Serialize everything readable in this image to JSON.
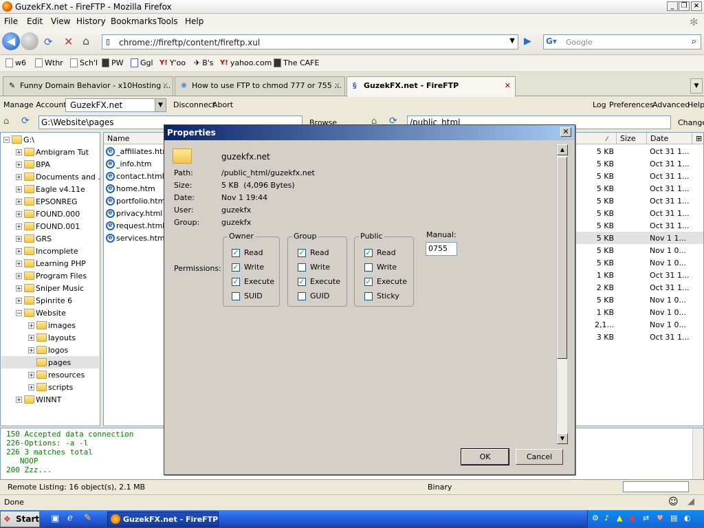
{
  "window": {
    "title": "GuzekFX.net - FireFTP - Mozilla Firefox"
  },
  "menu": [
    "File",
    "Edit",
    "View",
    "History",
    "Bookmarks",
    "Tools",
    "Help"
  ],
  "nav": {
    "url": "chrome://fireftp/content/fireftp.xul",
    "search_placeholder": "Google"
  },
  "bookmarks": [
    "w6",
    "Wthr",
    "Sch'l",
    "PW",
    "Ggl",
    "Y'oo",
    "B's",
    "yahoo.com",
    "The CAFE"
  ],
  "tabs": [
    {
      "label": "Funny Domain Behavior - x10Hosting ..."
    },
    {
      "label": "How to use FTP to chmod 777 or 755 ..."
    },
    {
      "label": "GuzekFX.net - FireFTP"
    }
  ],
  "ftp_toolbar": {
    "manage_accounts": "Manage Accounts",
    "account": "GuzekFX.net",
    "disconnect": "Disconnect",
    "abort": "Abort",
    "log": "Log",
    "preferences": "Preferences",
    "advanced": "Advanced",
    "help": "Help"
  },
  "paths": {
    "local": "G:\\Website\\pages",
    "browse": "Browse",
    "remote": "/public_html",
    "change": "Change"
  },
  "tree": {
    "root": "G:\\",
    "items": [
      "Ambigram Tut",
      "BPA",
      "Documents and ...",
      "Eagle v4.11e",
      "EPSONREG",
      "FOUND.000",
      "FOUND.001",
      "GRS",
      "Incomplete",
      "Learning PHP",
      "Program Files",
      "Sniper Music",
      "Spinrite 6",
      "Website"
    ],
    "website_children": [
      "images",
      "layouts",
      "logos",
      "pages",
      "resources",
      "scripts"
    ],
    "last": "WINNT"
  },
  "local_files": {
    "header": "Name",
    "items": [
      "_affiliates.htm",
      "_info.htm",
      "contact.html",
      "home.htm",
      "portfolio.htm",
      "privacy.html",
      "request.html",
      "services.html"
    ]
  },
  "remote_files": {
    "headers": {
      "size": "Size",
      "date": "Date"
    },
    "rows": [
      {
        "size": "5 KB",
        "date": "Oct 31 1..."
      },
      {
        "size": "5 KB",
        "date": "Oct 31 1..."
      },
      {
        "size": "5 KB",
        "date": "Oct 31 1..."
      },
      {
        "size": "5 KB",
        "date": "Oct 31 1..."
      },
      {
        "size": "5 KB",
        "date": "Oct 31 1..."
      },
      {
        "size": "5 KB",
        "date": "Oct 31 1..."
      },
      {
        "size": "5 KB",
        "date": "Oct 31 1..."
      },
      {
        "size": "5 KB",
        "date": "Nov 1 1..."
      },
      {
        "size": "5 KB",
        "date": "Nov 1 0..."
      },
      {
        "size": "5 KB",
        "date": "Nov 1 0..."
      },
      {
        "size": "1 KB",
        "date": "Oct 31 1..."
      },
      {
        "size": "2 KB",
        "date": "Oct 31 1..."
      },
      {
        "size": "5 KB",
        "date": "Nov 1 0..."
      },
      {
        "size": "1 KB",
        "date": "Nov 1 0..."
      },
      {
        "size": "2,1...",
        "date": "Nov 1 0..."
      },
      {
        "size": "3 KB",
        "date": "Oct 31 1..."
      }
    ]
  },
  "log": [
    "150 Accepted data connection",
    "226-Options: -a -l",
    "226 3 matches total",
    "   NOOP",
    "200 Zzz..."
  ],
  "ftp_status": {
    "listing": "Remote Listing: 16 object(s), 2.1 MB",
    "mode": "Binary"
  },
  "ff_status": "Done",
  "taskbar": {
    "start": "Start",
    "task": "GuzekFX.net - FireFTP ..."
  },
  "dialog": {
    "title": "Properties",
    "filename": "guzekfx.net",
    "fields": [
      {
        "label": "Path:",
        "value": "/public_html/guzekfx.net"
      },
      {
        "label": "Size:",
        "value": "5 KB  (4,096 Bytes)"
      },
      {
        "label": "Date:",
        "value": "Nov 1 19:44"
      },
      {
        "label": "User:",
        "value": "guzekfx"
      },
      {
        "label": "Group:",
        "value": "guzekfx"
      }
    ],
    "permissions_label": "Permissions:",
    "groups": [
      {
        "name": "Owner",
        "items": [
          {
            "label": "Read",
            "checked": true
          },
          {
            "label": "Write",
            "checked": true
          },
          {
            "label": "Execute",
            "checked": true
          },
          {
            "label": "SUID",
            "checked": false
          }
        ]
      },
      {
        "name": "Group",
        "items": [
          {
            "label": "Read",
            "checked": true
          },
          {
            "label": "Write",
            "checked": false
          },
          {
            "label": "Execute",
            "checked": true
          },
          {
            "label": "GUID",
            "checked": false
          }
        ]
      },
      {
        "name": "Public",
        "items": [
          {
            "label": "Read",
            "checked": true
          },
          {
            "label": "Write",
            "checked": false
          },
          {
            "label": "Execute",
            "checked": true
          },
          {
            "label": "Sticky",
            "checked": false
          }
        ]
      }
    ],
    "manual_label": "Manual:",
    "manual_value": "0755",
    "ok": "OK",
    "cancel": "Cancel"
  }
}
